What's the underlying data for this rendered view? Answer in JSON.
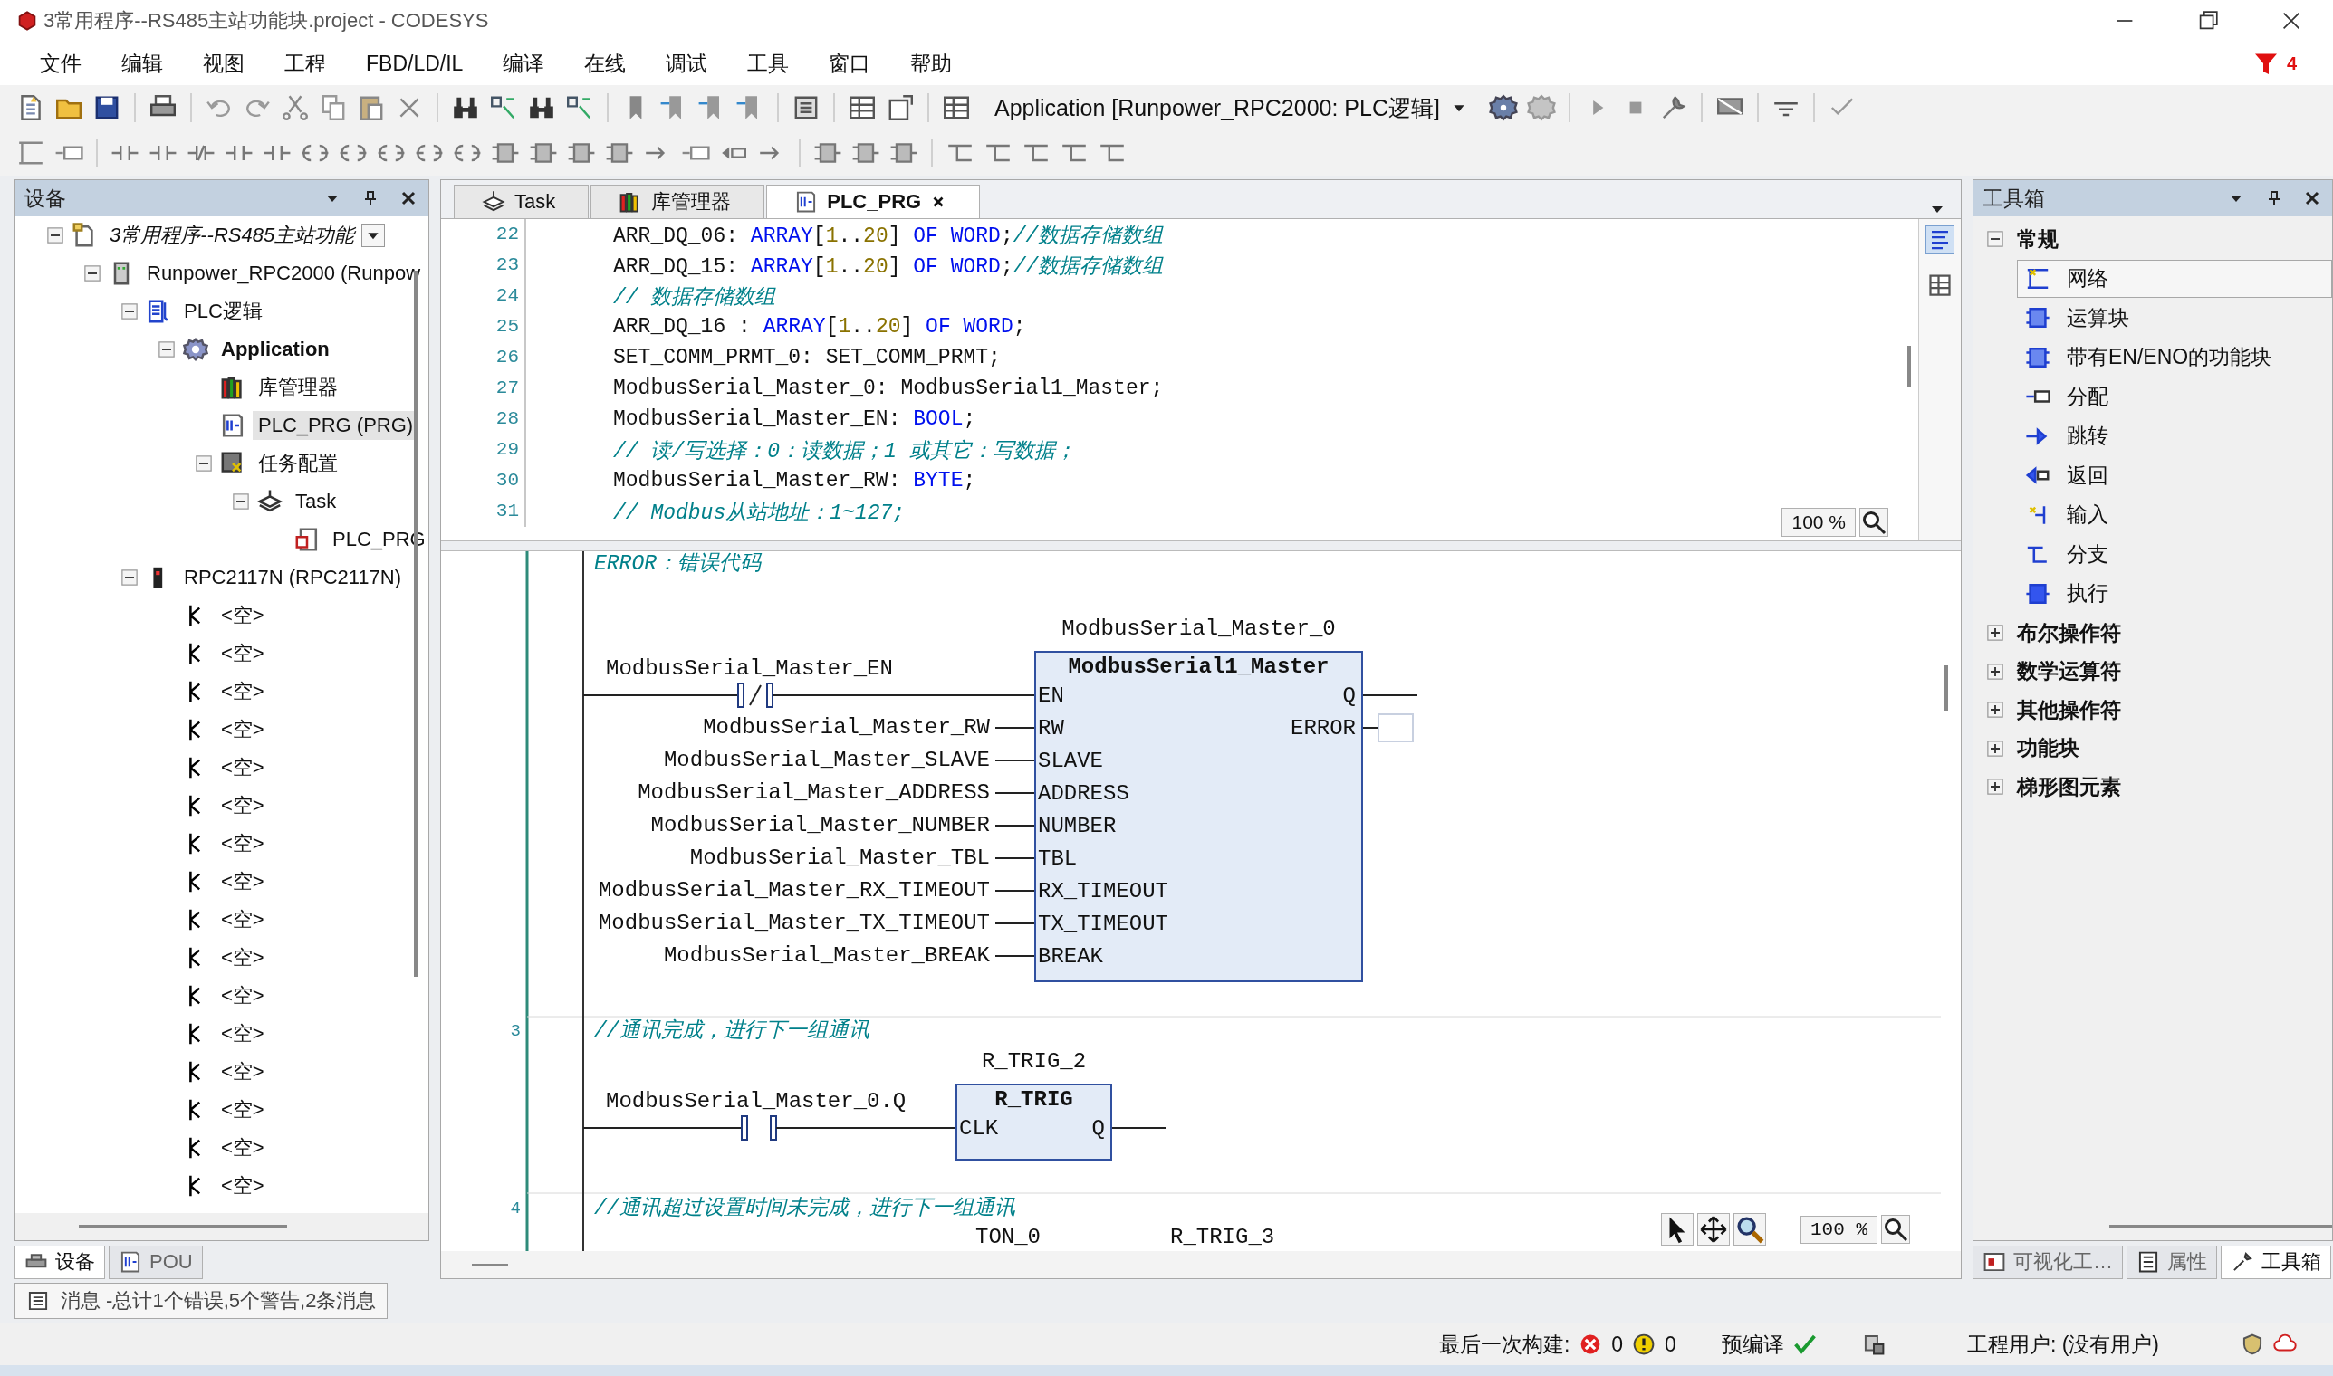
{
  "window": {
    "title": "3常用程序--RS485主站功能块.project - CODESYS"
  },
  "menu": [
    "文件",
    "编辑",
    "视图",
    "工程",
    "FBD/LD/IL",
    "编译",
    "在线",
    "调试",
    "工具",
    "窗口",
    "帮助"
  ],
  "toolbar": {
    "application": "Application [Runpower_RPC2000: PLC逻辑]",
    "alert_count": "4"
  },
  "devices_panel": {
    "title": "设备",
    "tree": [
      {
        "label": "3常用程序--RS485主站功能",
        "kind": "project",
        "expanded": true,
        "selected": false,
        "children": [
          {
            "label": "Runpower_RPC2000 (Runpow",
            "kind": "device",
            "expanded": true,
            "selected": false,
            "children": [
              {
                "label": "PLC逻辑",
                "kind": "plc-logic",
                "expanded": true,
                "selected": false,
                "children": [
                  {
                    "label": "Application",
                    "kind": "application",
                    "expanded": true,
                    "selected": false,
                    "children": [
                      {
                        "label": "库管理器",
                        "kind": "library",
                        "selected": false
                      },
                      {
                        "label": "PLC_PRG (PRG)",
                        "kind": "pou",
                        "selected": true
                      },
                      {
                        "label": "任务配置",
                        "kind": "task-config",
                        "expanded": true,
                        "selected": false,
                        "children": [
                          {
                            "label": "Task",
                            "kind": "task",
                            "expanded": true,
                            "selected": false,
                            "children": [
                              {
                                "label": "PLC_PRG",
                                "kind": "task-pou",
                                "selected": false
                              }
                            ]
                          }
                        ]
                      }
                    ]
                  }
                ]
              },
              {
                "label": "RPC2117N (RPC2117N)",
                "kind": "module",
                "expanded": true,
                "selected": false,
                "children": [
                  {
                    "label": "<空>",
                    "kind": "slot",
                    "selected": false
                  },
                  {
                    "label": "<空>",
                    "kind": "slot",
                    "selected": false
                  },
                  {
                    "label": "<空>",
                    "kind": "slot",
                    "selected": false
                  },
                  {
                    "label": "<空>",
                    "kind": "slot",
                    "selected": false
                  },
                  {
                    "label": "<空>",
                    "kind": "slot",
                    "selected": false
                  },
                  {
                    "label": "<空>",
                    "kind": "slot",
                    "selected": false
                  },
                  {
                    "label": "<空>",
                    "kind": "slot",
                    "selected": false
                  },
                  {
                    "label": "<空>",
                    "kind": "slot",
                    "selected": false
                  },
                  {
                    "label": "<空>",
                    "kind": "slot",
                    "selected": false
                  },
                  {
                    "label": "<空>",
                    "kind": "slot",
                    "selected": false
                  },
                  {
                    "label": "<空>",
                    "kind": "slot",
                    "selected": false
                  },
                  {
                    "label": "<空>",
                    "kind": "slot",
                    "selected": false
                  },
                  {
                    "label": "<空>",
                    "kind": "slot",
                    "selected": false
                  },
                  {
                    "label": "<空>",
                    "kind": "slot",
                    "selected": false
                  },
                  {
                    "label": "<空>",
                    "kind": "slot",
                    "selected": false
                  },
                  {
                    "label": "<空>",
                    "kind": "slot",
                    "selected": false
                  }
                ]
              }
            ]
          }
        ]
      }
    ],
    "tabs": [
      {
        "label": "设备",
        "kind": "devices",
        "selected": true
      },
      {
        "label": "POU",
        "kind": "pou",
        "selected": false
      }
    ]
  },
  "editor": {
    "tabs": [
      {
        "label": "Task",
        "kind": "task",
        "selected": false,
        "closable": false
      },
      {
        "label": "库管理器",
        "kind": "library",
        "selected": false,
        "closable": false
      },
      {
        "label": "PLC_PRG",
        "kind": "pou",
        "selected": true,
        "closable": true
      }
    ],
    "declaration": {
      "zoom": "100 %",
      "lines": [
        {
          "number": "22",
          "tokens": [
            {
              "text": "ARR_DQ_06: ",
              "kind": "plain"
            },
            {
              "text": "ARRAY",
              "kind": "keyword"
            },
            {
              "text": "[",
              "kind": "plain"
            },
            {
              "text": "1",
              "kind": "number"
            },
            {
              "text": "..",
              "kind": "plain"
            },
            {
              "text": "20",
              "kind": "number"
            },
            {
              "text": "] ",
              "kind": "plain"
            },
            {
              "text": "OF WORD",
              "kind": "keyword"
            },
            {
              "text": ";",
              "kind": "plain"
            },
            {
              "text": "//数据存储数组",
              "kind": "comment"
            }
          ]
        },
        {
          "number": "23",
          "tokens": [
            {
              "text": "ARR_DQ_15: ",
              "kind": "plain"
            },
            {
              "text": "ARRAY",
              "kind": "keyword"
            },
            {
              "text": "[",
              "kind": "plain"
            },
            {
              "text": "1",
              "kind": "number"
            },
            {
              "text": "..",
              "kind": "plain"
            },
            {
              "text": "20",
              "kind": "number"
            },
            {
              "text": "] ",
              "kind": "plain"
            },
            {
              "text": "OF WORD",
              "kind": "keyword"
            },
            {
              "text": ";",
              "kind": "plain"
            },
            {
              "text": "//数据存储数组",
              "kind": "comment"
            }
          ]
        },
        {
          "number": "24",
          "tokens": [
            {
              "text": "// 数据存储数组",
              "kind": "comment"
            }
          ]
        },
        {
          "number": "25",
          "tokens": [
            {
              "text": "ARR_DQ_16 : ",
              "kind": "plain"
            },
            {
              "text": "ARRAY",
              "kind": "keyword"
            },
            {
              "text": "[",
              "kind": "plain"
            },
            {
              "text": "1",
              "kind": "number"
            },
            {
              "text": "..",
              "kind": "plain"
            },
            {
              "text": "20",
              "kind": "number"
            },
            {
              "text": "] ",
              "kind": "plain"
            },
            {
              "text": "OF WORD",
              "kind": "keyword"
            },
            {
              "text": ";",
              "kind": "plain"
            }
          ]
        },
        {
          "number": "26",
          "tokens": [
            {
              "text": "SET_COMM_PRMT_0: SET_COMM_PRMT;",
              "kind": "plain"
            }
          ]
        },
        {
          "number": "27",
          "tokens": [
            {
              "text": "ModbusSerial_Master_0: ModbusSerial1_Master;",
              "kind": "plain"
            }
          ]
        },
        {
          "number": "28",
          "tokens": [
            {
              "text": "ModbusSerial_Master_EN: ",
              "kind": "plain"
            },
            {
              "text": "BOOL",
              "kind": "keyword"
            },
            {
              "text": ";",
              "kind": "plain"
            }
          ]
        },
        {
          "number": "29",
          "tokens": [
            {
              "text": "// 读/写选择：0：读数据；1 或其它：写数据；",
              "kind": "comment"
            }
          ]
        },
        {
          "number": "30",
          "tokens": [
            {
              "text": "ModbusSerial_Master_RW: ",
              "kind": "plain"
            },
            {
              "text": "BYTE",
              "kind": "keyword"
            },
            {
              "text": ";",
              "kind": "plain"
            }
          ]
        },
        {
          "number": "31",
          "tokens": [
            {
              "text": "// Modbus从站地址：1~127;",
              "kind": "comment"
            }
          ]
        }
      ]
    },
    "fbd": {
      "zoom": "100 %",
      "networks": [
        {
          "comment": "ERROR：错误代码",
          "instance": "ModbusSerial_Master_0",
          "block": "ModbusSerial1_Master",
          "contact": {
            "variable": "ModbusSerial_Master_EN",
            "negated": true
          },
          "contact_pin": "EN",
          "inputs": [
            {
              "pin": "RW",
              "variable": "ModbusSerial_Master_RW"
            },
            {
              "pin": "SLAVE",
              "variable": "ModbusSerial_Master_SLAVE"
            },
            {
              "pin": "ADDRESS",
              "variable": "ModbusSerial_Master_ADDRESS"
            },
            {
              "pin": "NUMBER",
              "variable": "ModbusSerial_Master_NUMBER"
            },
            {
              "pin": "TBL",
              "variable": "ModbusSerial_Master_TBL"
            },
            {
              "pin": "RX_TIMEOUT",
              "variable": "ModbusSerial_Master_RX_TIMEOUT"
            },
            {
              "pin": "TX_TIMEOUT",
              "variable": "ModbusSerial_Master_TX_TIMEOUT"
            },
            {
              "pin": "BREAK",
              "variable": "ModbusSerial_Master_BREAK"
            }
          ],
          "outputs": [
            {
              "pin": "Q",
              "kind": "line"
            },
            {
              "pin": "ERROR",
              "kind": "empty-box"
            }
          ]
        },
        {
          "number": "3",
          "comment": "//通讯完成，进行下一组通讯",
          "instance": "R_TRIG_2",
          "block": "R_TRIG",
          "contact": {
            "variable": "ModbusSerial_Master_0.Q",
            "negated": false
          },
          "contact_pin": "CLK",
          "outputs": [
            {
              "pin": "Q",
              "kind": "line"
            }
          ]
        },
        {
          "number": "4",
          "comment": "//通讯超过设置时间未完成，进行下一组通讯",
          "instances": [
            "TON_0",
            "R_TRIG_3"
          ]
        }
      ]
    }
  },
  "toolbox": {
    "title": "工具箱",
    "groups": [
      {
        "label": "常规",
        "expanded": true,
        "items": [
          {
            "label": "网络",
            "kind": "network",
            "selected": true
          },
          {
            "label": "运算块",
            "kind": "box",
            "selected": false
          },
          {
            "label": "带有EN/ENO的功能块",
            "kind": "box-en",
            "selected": false
          },
          {
            "label": "分配",
            "kind": "assign",
            "selected": false
          },
          {
            "label": "跳转",
            "kind": "jump",
            "selected": false
          },
          {
            "label": "返回",
            "kind": "return",
            "selected": false
          },
          {
            "label": "输入",
            "kind": "input",
            "selected": false
          },
          {
            "label": "分支",
            "kind": "branch",
            "selected": false
          },
          {
            "label": "执行",
            "kind": "execute",
            "selected": false
          }
        ]
      },
      {
        "label": "布尔操作符",
        "expanded": false
      },
      {
        "label": "数学运算符",
        "expanded": false
      },
      {
        "label": "其他操作符",
        "expanded": false
      },
      {
        "label": "功能块",
        "expanded": false
      },
      {
        "label": "梯形图元素",
        "expanded": false
      }
    ],
    "tabs": [
      {
        "label": "可视化工…",
        "kind": "visual",
        "selected": false
      },
      {
        "label": "属性",
        "kind": "props",
        "selected": false
      },
      {
        "label": "工具箱",
        "kind": "tools",
        "selected": true
      }
    ]
  },
  "messages": {
    "label": "消息 -总计1个错误,5个警告,2条消息"
  },
  "status_bar": {
    "build_label": "最后一次构建:",
    "errors": "0",
    "warnings": "0",
    "precompile": "预编译",
    "precompile_ok": true,
    "user": "工程用户: (没有用户)"
  }
}
